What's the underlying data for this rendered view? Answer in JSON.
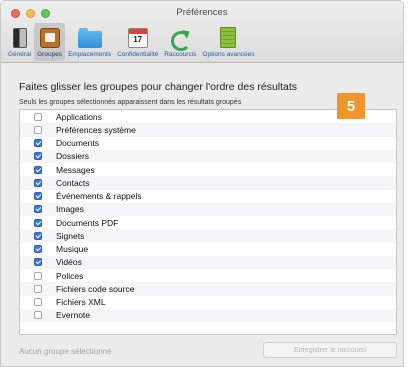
{
  "window": {
    "title": "Préférences"
  },
  "toolbar": {
    "items": [
      {
        "label": "Général",
        "icon": "general-icon"
      },
      {
        "label": "Groupes",
        "icon": "groups-icon",
        "selected": true
      },
      {
        "label": "Emplacements",
        "icon": "folder-icon"
      },
      {
        "label": "Confidentialité",
        "icon": "calendar-icon",
        "icon_text": "17"
      },
      {
        "label": "Raccourcis",
        "icon": "arrow-icon"
      },
      {
        "label": "Options avancées",
        "icon": "advanced-icon"
      }
    ]
  },
  "main": {
    "heading": "Faites glisser les groupes pour changer l'ordre des résultats",
    "subheading": "Seuls les groupes sélectionnés apparaissent dans les résultats groupés",
    "badge": "5",
    "groups": [
      {
        "label": "Applications",
        "checked": false
      },
      {
        "label": "Préférences système",
        "checked": false
      },
      {
        "label": "Documents",
        "checked": true
      },
      {
        "label": "Dossiers",
        "checked": true
      },
      {
        "label": "Messages",
        "checked": true
      },
      {
        "label": "Contacts",
        "checked": true
      },
      {
        "label": "Événements & rappels",
        "checked": true
      },
      {
        "label": "Images",
        "checked": true
      },
      {
        "label": "Documents PDF",
        "checked": true
      },
      {
        "label": "Signets",
        "checked": true
      },
      {
        "label": "Musique",
        "checked": true
      },
      {
        "label": "Vidéos",
        "checked": true
      },
      {
        "label": "Polices",
        "checked": false
      },
      {
        "label": "Fichiers code source",
        "checked": false
      },
      {
        "label": "Fichiers XML",
        "checked": false
      },
      {
        "label": "Evernote",
        "checked": false
      }
    ]
  },
  "footer": {
    "status": "Aucun groupe sélectionné",
    "record_button": "Enregistrer le raccourci"
  },
  "colors": {
    "accent": "#3a79d9",
    "badge": "#f0962b"
  }
}
